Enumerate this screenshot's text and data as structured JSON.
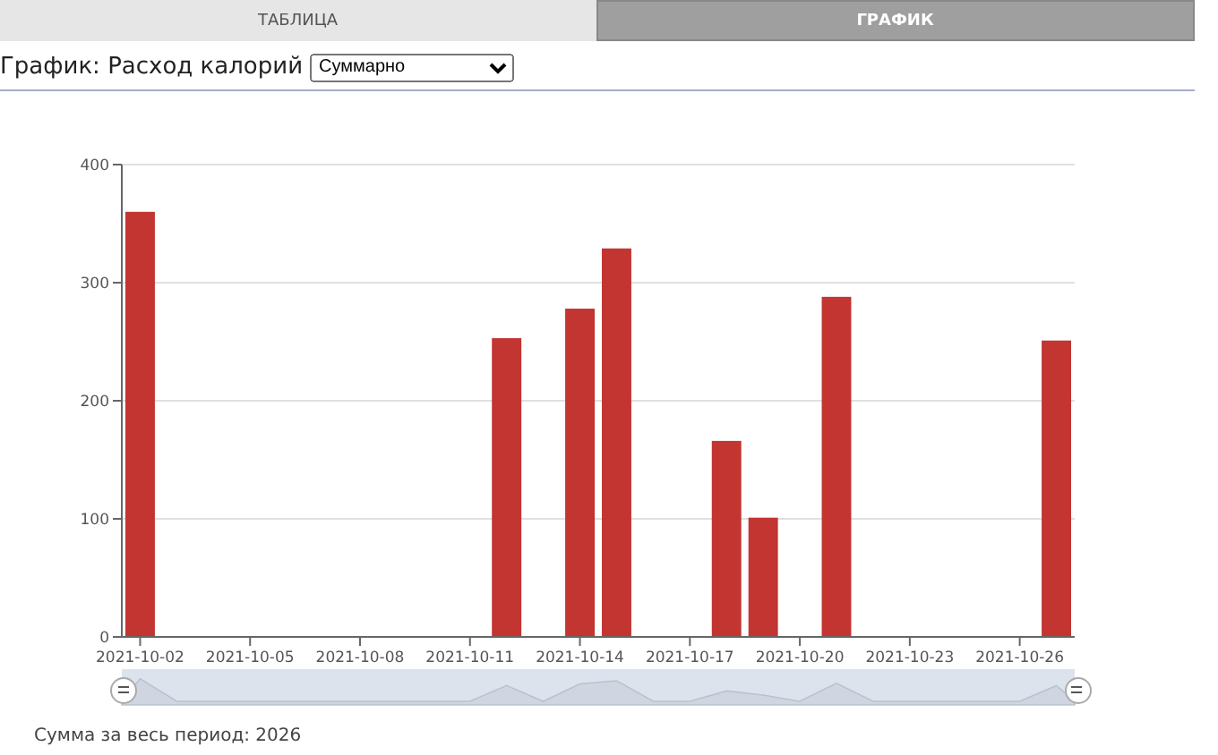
{
  "tabs": [
    {
      "label": "ТАБЛИЦА",
      "selected": false
    },
    {
      "label": "ГРАФИК",
      "selected": true
    }
  ],
  "header": {
    "title": "График: Расход калорий",
    "select_value": "Суммарно"
  },
  "chart": {
    "chart_data": {
      "type": "bar",
      "grid": true,
      "categories": [
        "2021-10-02",
        null,
        null,
        "2021-10-05",
        null,
        null,
        "2021-10-08",
        null,
        null,
        "2021-10-11",
        null,
        null,
        "2021-10-14",
        null,
        null,
        "2021-10-17",
        null,
        null,
        "2021-10-20",
        null,
        null,
        "2021-10-23",
        null,
        null,
        "2021-10-26",
        null
      ],
      "series": [
        {
          "color": "#c23531",
          "values": [
            360,
            0,
            0,
            0,
            0,
            0,
            0,
            0,
            0,
            0,
            253,
            0,
            278,
            329,
            0,
            0,
            166,
            101,
            0,
            288,
            0,
            0,
            0,
            0,
            0,
            251
          ]
        }
      ],
      "ylim": [
        0,
        400
      ],
      "yticks": [
        0,
        100,
        200,
        300,
        400
      ]
    }
  },
  "footer": {
    "text": "Сумма за весь период: 2026"
  }
}
